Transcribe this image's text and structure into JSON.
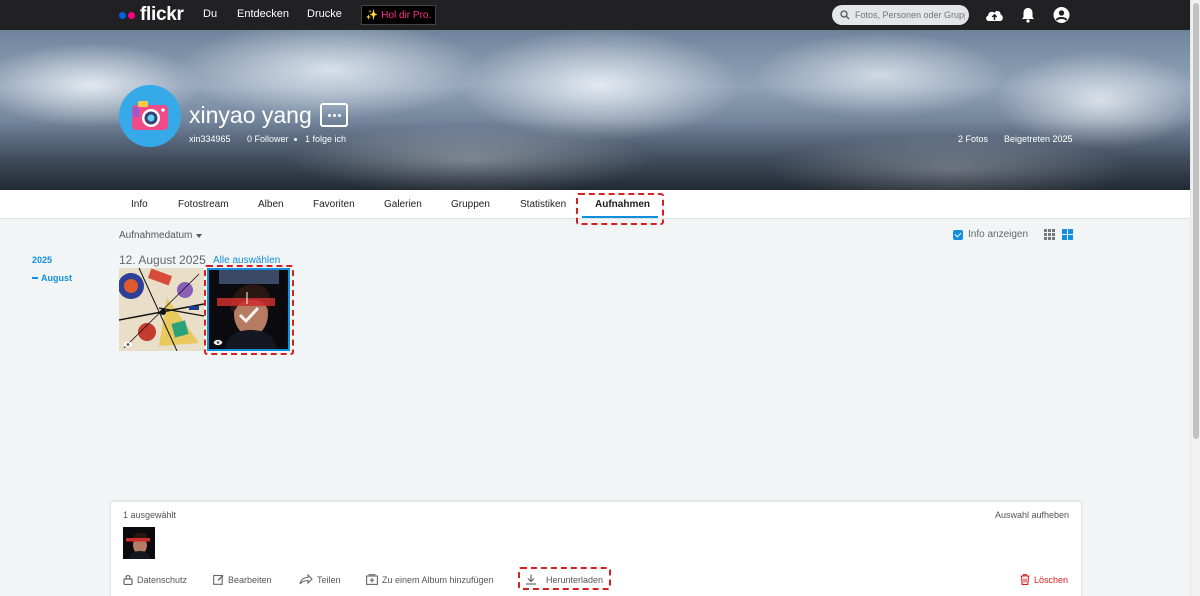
{
  "topnav": {
    "logo_text": "flickr",
    "links": [
      "Du",
      "Entdecken",
      "Drucke"
    ],
    "pro_label": "Hol dir Pro.",
    "search_placeholder": "Fotos, Personen oder Gruppen"
  },
  "profile": {
    "name": "xinyao yang",
    "handle": "xin334965",
    "followers": "0 Follower",
    "following": "1 folge ich",
    "photo_count": "2 Fotos",
    "joined": "Beigetreten 2025"
  },
  "tabs": [
    {
      "label": "Info"
    },
    {
      "label": "Fotostream"
    },
    {
      "label": "Alben"
    },
    {
      "label": "Favoriten"
    },
    {
      "label": "Galerien"
    },
    {
      "label": "Gruppen"
    },
    {
      "label": "Statistiken"
    },
    {
      "label": "Aufnahmen",
      "active": true
    }
  ],
  "toolbar": {
    "sort_label": "Aufnahmedatum",
    "info_label": "Info anzeigen",
    "info_checked": true
  },
  "timeline": {
    "year": "2025",
    "month": "August"
  },
  "group": {
    "date": "12. August 2025",
    "select_all": "Alle auswählen"
  },
  "selection": {
    "count": "1 ausgewählt",
    "clear": "Auswahl aufheben",
    "actions": {
      "privacy": "Datenschutz",
      "edit": "Bearbeiten",
      "share": "Teilen",
      "add_album": "Zu einem Album hinzufügen",
      "download": "Herunterladen",
      "delete": "Löschen"
    }
  },
  "colors": {
    "accent": "#128fdc",
    "topbar": "#212124",
    "danger": "#d32020",
    "pro_text": "#ff2d88"
  }
}
